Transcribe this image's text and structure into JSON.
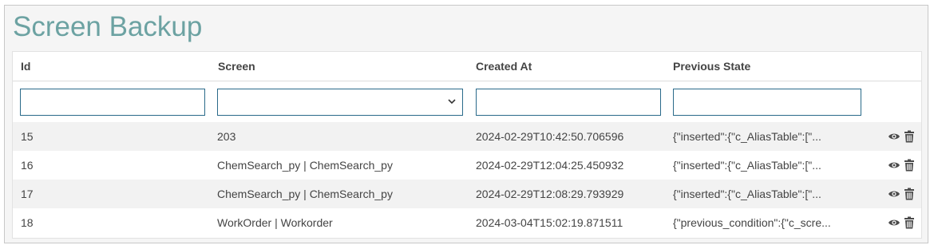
{
  "page": {
    "title": "Screen Backup"
  },
  "table": {
    "columns": [
      "Id",
      "Screen",
      "Created At",
      "Previous State"
    ],
    "rows": [
      {
        "id": "15",
        "screen": "203",
        "created_at": "2024-02-29T10:42:50.706596",
        "previous_state": "{\"inserted\":{\"c_AliasTable\":[\"..."
      },
      {
        "id": "16",
        "screen": "ChemSearch_py | ChemSearch_py",
        "created_at": "2024-02-29T12:04:25.450932",
        "previous_state": "{\"inserted\":{\"c_AliasTable\":[\"..."
      },
      {
        "id": "17",
        "screen": "ChemSearch_py | ChemSearch_py",
        "created_at": "2024-02-29T12:08:29.793929",
        "previous_state": "{\"inserted\":{\"c_AliasTable\":[\"..."
      },
      {
        "id": "18",
        "screen": "WorkOrder | Workorder",
        "created_at": "2024-03-04T15:02:19.871511",
        "previous_state": "{\"previous_condition\":{\"c_scre..."
      }
    ]
  },
  "icons": {
    "view": "eye-icon",
    "delete": "trash-icon"
  },
  "colors": {
    "title": "#6ca2a2",
    "input_border": "#2a6a8a",
    "icon": "#4a4a4a"
  }
}
